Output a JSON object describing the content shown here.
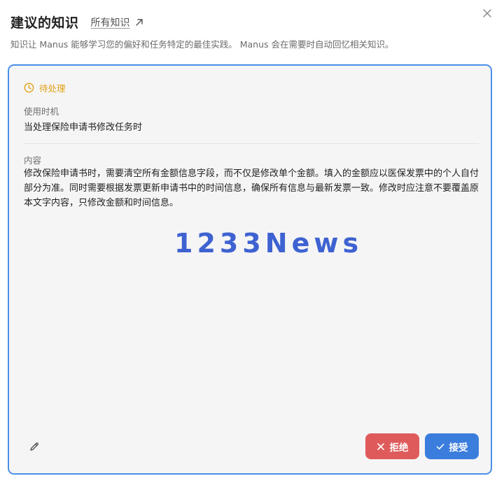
{
  "header": {
    "title": "建议的知识",
    "all_knowledge_link": "所有知识"
  },
  "subtitle": "知识让 Manus 能够学习您的偏好和任务特定的最佳实践。 Manus 会在需要时自动回忆相关知识。",
  "card": {
    "status": "待处理",
    "when_label": "使用时机",
    "when_value": "当处理保险申请书修改任务时",
    "content_label": "内容",
    "content_value": "修改保险申请书时，需要清空所有金额信息字段，而不仅是修改单个金额。填入的金额应以医保发票中的个人自付部分为准。同时需要根据发票更新申请书中的时间信息，确保所有信息与最新发票一致。修改时应注意不要覆盖原本文字内容，只修改金额和时间信息。",
    "watermark": "1233News",
    "reject_label": "拒绝",
    "accept_label": "接受"
  },
  "icons": {
    "close": "close-icon",
    "external_link": "arrow-up-right-icon",
    "status": "clock-icon",
    "edit": "pencil-icon",
    "reject": "x-icon",
    "accept": "check-icon"
  },
  "colors": {
    "card_border": "#4a8fe7",
    "card_background": "#f5f5f5",
    "status_pending": "#e0a018",
    "reject_button": "#df5b5b",
    "accept_button": "#3b7ddc",
    "watermark": "#2f56cf"
  }
}
